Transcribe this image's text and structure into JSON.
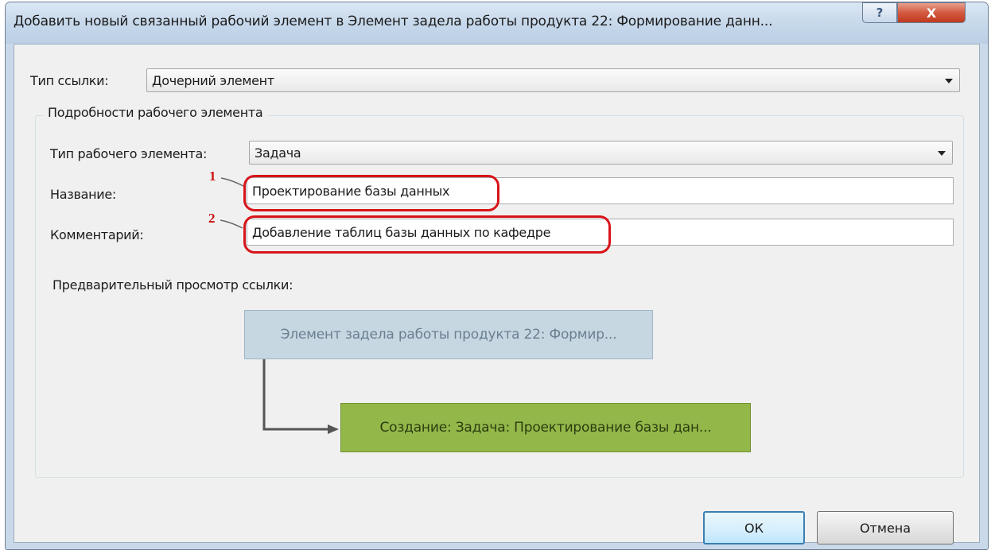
{
  "window": {
    "title": "Добавить новый связанный рабочий элемент в Элемент задела работы продукта 22: Формирование данн...",
    "help_label": "?",
    "close_label": "X"
  },
  "link_type": {
    "label": "Тип ссылки:",
    "value": "Дочерний элемент"
  },
  "details": {
    "group_title": "Подробности рабочего элемента",
    "work_item_type_label": "Тип рабочего элемента:",
    "work_item_type_value": "Задача",
    "name_label": "Название:",
    "name_value": "Проектирование базы данных",
    "comment_label": "Комментарий:",
    "comment_value": "Добавление таблиц базы данных по кафедре",
    "preview_label": "Предварительный просмотр ссылки:"
  },
  "preview": {
    "parent_node": "Элемент задела работы продукта 22: Формир...",
    "child_node": "Создание: Задача: Проектирование базы дан...",
    "parent_color": "#c6d7e2",
    "child_color": "#94b74a"
  },
  "buttons": {
    "ok": "ОК",
    "cancel": "Отмена"
  },
  "annotations": {
    "marker_1": "1",
    "marker_2": "2",
    "color": "#d8141a"
  }
}
